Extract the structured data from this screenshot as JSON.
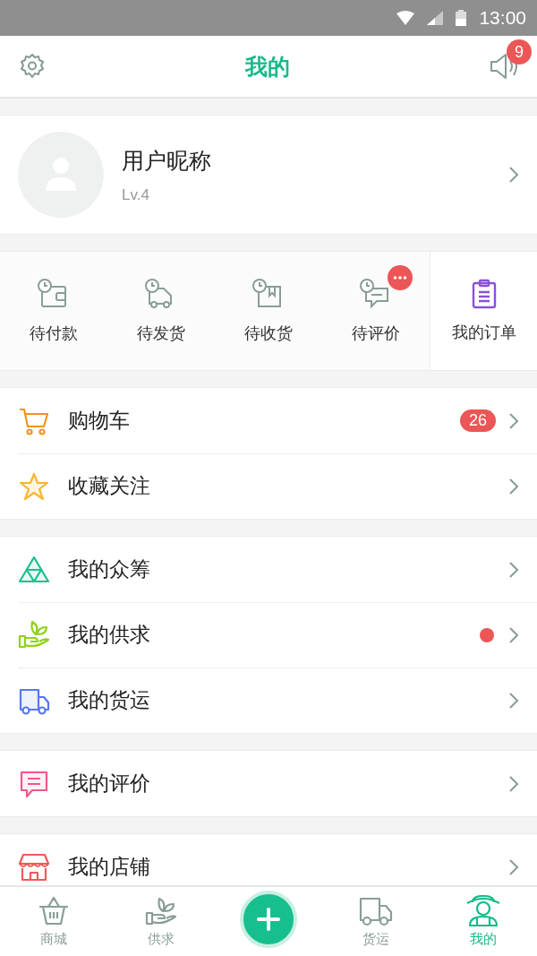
{
  "status_bar": {
    "time": "13:00"
  },
  "header": {
    "title": "我的",
    "notification_count": "9"
  },
  "profile": {
    "nickname": "用户昵称",
    "level": "Lv.4"
  },
  "orders": {
    "items": [
      {
        "label": "待付款",
        "badge": false
      },
      {
        "label": "待发货",
        "badge": false
      },
      {
        "label": "待收货",
        "badge": false
      },
      {
        "label": "待评价",
        "badge": true
      }
    ],
    "all_label": "我的订单"
  },
  "menu_groups": [
    {
      "items": [
        {
          "label": "购物车",
          "count": "26",
          "dot": false
        },
        {
          "label": "收藏关注",
          "dot": false
        }
      ]
    },
    {
      "items": [
        {
          "label": "我的众筹",
          "dot": false
        },
        {
          "label": "我的供求",
          "dot": true
        },
        {
          "label": "我的货运",
          "dot": false
        }
      ]
    },
    {
      "items": [
        {
          "label": "我的评价",
          "dot": false
        }
      ]
    },
    {
      "items": [
        {
          "label": "我的店铺",
          "dot": false
        }
      ]
    }
  ],
  "tab_bar": {
    "tabs": [
      {
        "label": "商城",
        "selected": false
      },
      {
        "label": "供求",
        "selected": false
      },
      {
        "label": "货运",
        "selected": false
      },
      {
        "label": "我的",
        "selected": true
      }
    ]
  }
}
